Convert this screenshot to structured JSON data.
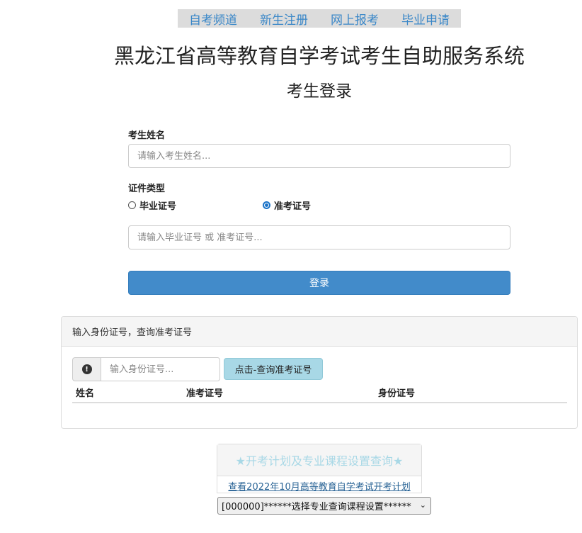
{
  "nav": {
    "items": [
      "自考频道",
      "新生注册",
      "网上报考",
      "毕业申请"
    ]
  },
  "header": {
    "title": "黑龙江省高等教育自学考试考生自助服务系统",
    "subtitle": "考生登录"
  },
  "login_form": {
    "name_label": "考生姓名",
    "name_placeholder": "请输入考生姓名...",
    "cert_type_label": "证件类型",
    "radio_graduation": "毕业证号",
    "radio_admission": "准考证号",
    "selected_radio": "准考证号",
    "cert_placeholder": "请输入毕业证号 或 准考证号...",
    "login_button": "登录"
  },
  "id_query": {
    "panel_title": "输入身份证号，查询准考证号",
    "id_placeholder": "输入身份证号...",
    "query_button": "点击-查询准考证号",
    "columns": [
      "姓名",
      "准考证号",
      "身份证号"
    ]
  },
  "plan": {
    "heading": "★开考计划及专业课程设置查询★",
    "link": "查看2022年10月高等教育自学考试开考计划",
    "select_value": "[000000]******选择专业查询课程设置******"
  },
  "colors": {
    "accent": "#428bca",
    "nav_link": "#3a87c8",
    "query_button": "#a8d8e6"
  }
}
